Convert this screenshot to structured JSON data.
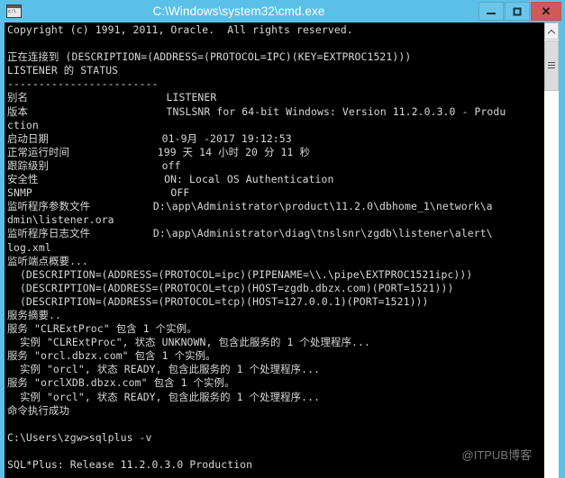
{
  "window": {
    "title": "C:\\Windows\\system32\\cmd.exe",
    "icon": "cmd-console-icon",
    "titlebar_color": "#5bc0e8",
    "close_button_color": "#d05a56",
    "console_bg": "#000000",
    "console_fg": "#d8d8d8"
  },
  "controls": {
    "minimize_label": "–",
    "maximize_label": "□",
    "close_label": "✕"
  },
  "scrollbar": {
    "up_arrow": "scroll-up-arrow",
    "thumb": "scroll-thumb"
  },
  "watermark": {
    "text": "@ITPUB博客"
  },
  "console": {
    "lines": [
      "Copyright (c) 1991, 2011, Oracle.  All rights reserved.",
      "",
      "正在连接到 (DESCRIPTION=(ADDRESS=(PROTOCOL=IPC)(KEY=EXTPROC1521)))",
      "LISTENER 的 STATUS",
      "------------------------",
      "别名                      LISTENER",
      "版本                      TNSLSNR for 64-bit Windows: Version 11.2.0.3.0 - Produ",
      "ction",
      "启动日期                  01-9月 -2017 19:12:53",
      "正常运行时间              199 天 14 小时 20 分 11 秒",
      "跟踪级别                  off",
      "安全性                    ON: Local OS Authentication",
      "SNMP                      OFF",
      "监听程序参数文件          D:\\app\\Administrator\\product\\11.2.0\\dbhome_1\\network\\a",
      "dmin\\listener.ora",
      "监听程序日志文件          D:\\app\\Administrator\\diag\\tnslsnr\\zgdb\\listener\\alert\\",
      "log.xml",
      "监听端点概要...",
      "  (DESCRIPTION=(ADDRESS=(PROTOCOL=ipc)(PIPENAME=\\\\.\\pipe\\EXTPROC1521ipc)))",
      "  (DESCRIPTION=(ADDRESS=(PROTOCOL=tcp)(HOST=zgdb.dbzx.com)(PORT=1521)))",
      "  (DESCRIPTION=(ADDRESS=(PROTOCOL=tcp)(HOST=127.0.0.1)(PORT=1521)))",
      "服务摘要..",
      "服务 \"CLRExtProc\" 包含 1 个实例。",
      "  实例 \"CLRExtProc\", 状态 UNKNOWN, 包含此服务的 1 个处理程序...",
      "服务 \"orcl.dbzx.com\" 包含 1 个实例。",
      "  实例 \"orcl\", 状态 READY, 包含此服务的 1 个处理程序...",
      "服务 \"orclXDB.dbzx.com\" 包含 1 个实例。",
      "  实例 \"orcl\", 状态 READY, 包含此服务的 1 个处理程序...",
      "命令执行成功",
      "",
      "C:\\Users\\zgw>sqlplus -v",
      "",
      "SQL*Plus: Release 11.2.0.3.0 Production"
    ]
  }
}
